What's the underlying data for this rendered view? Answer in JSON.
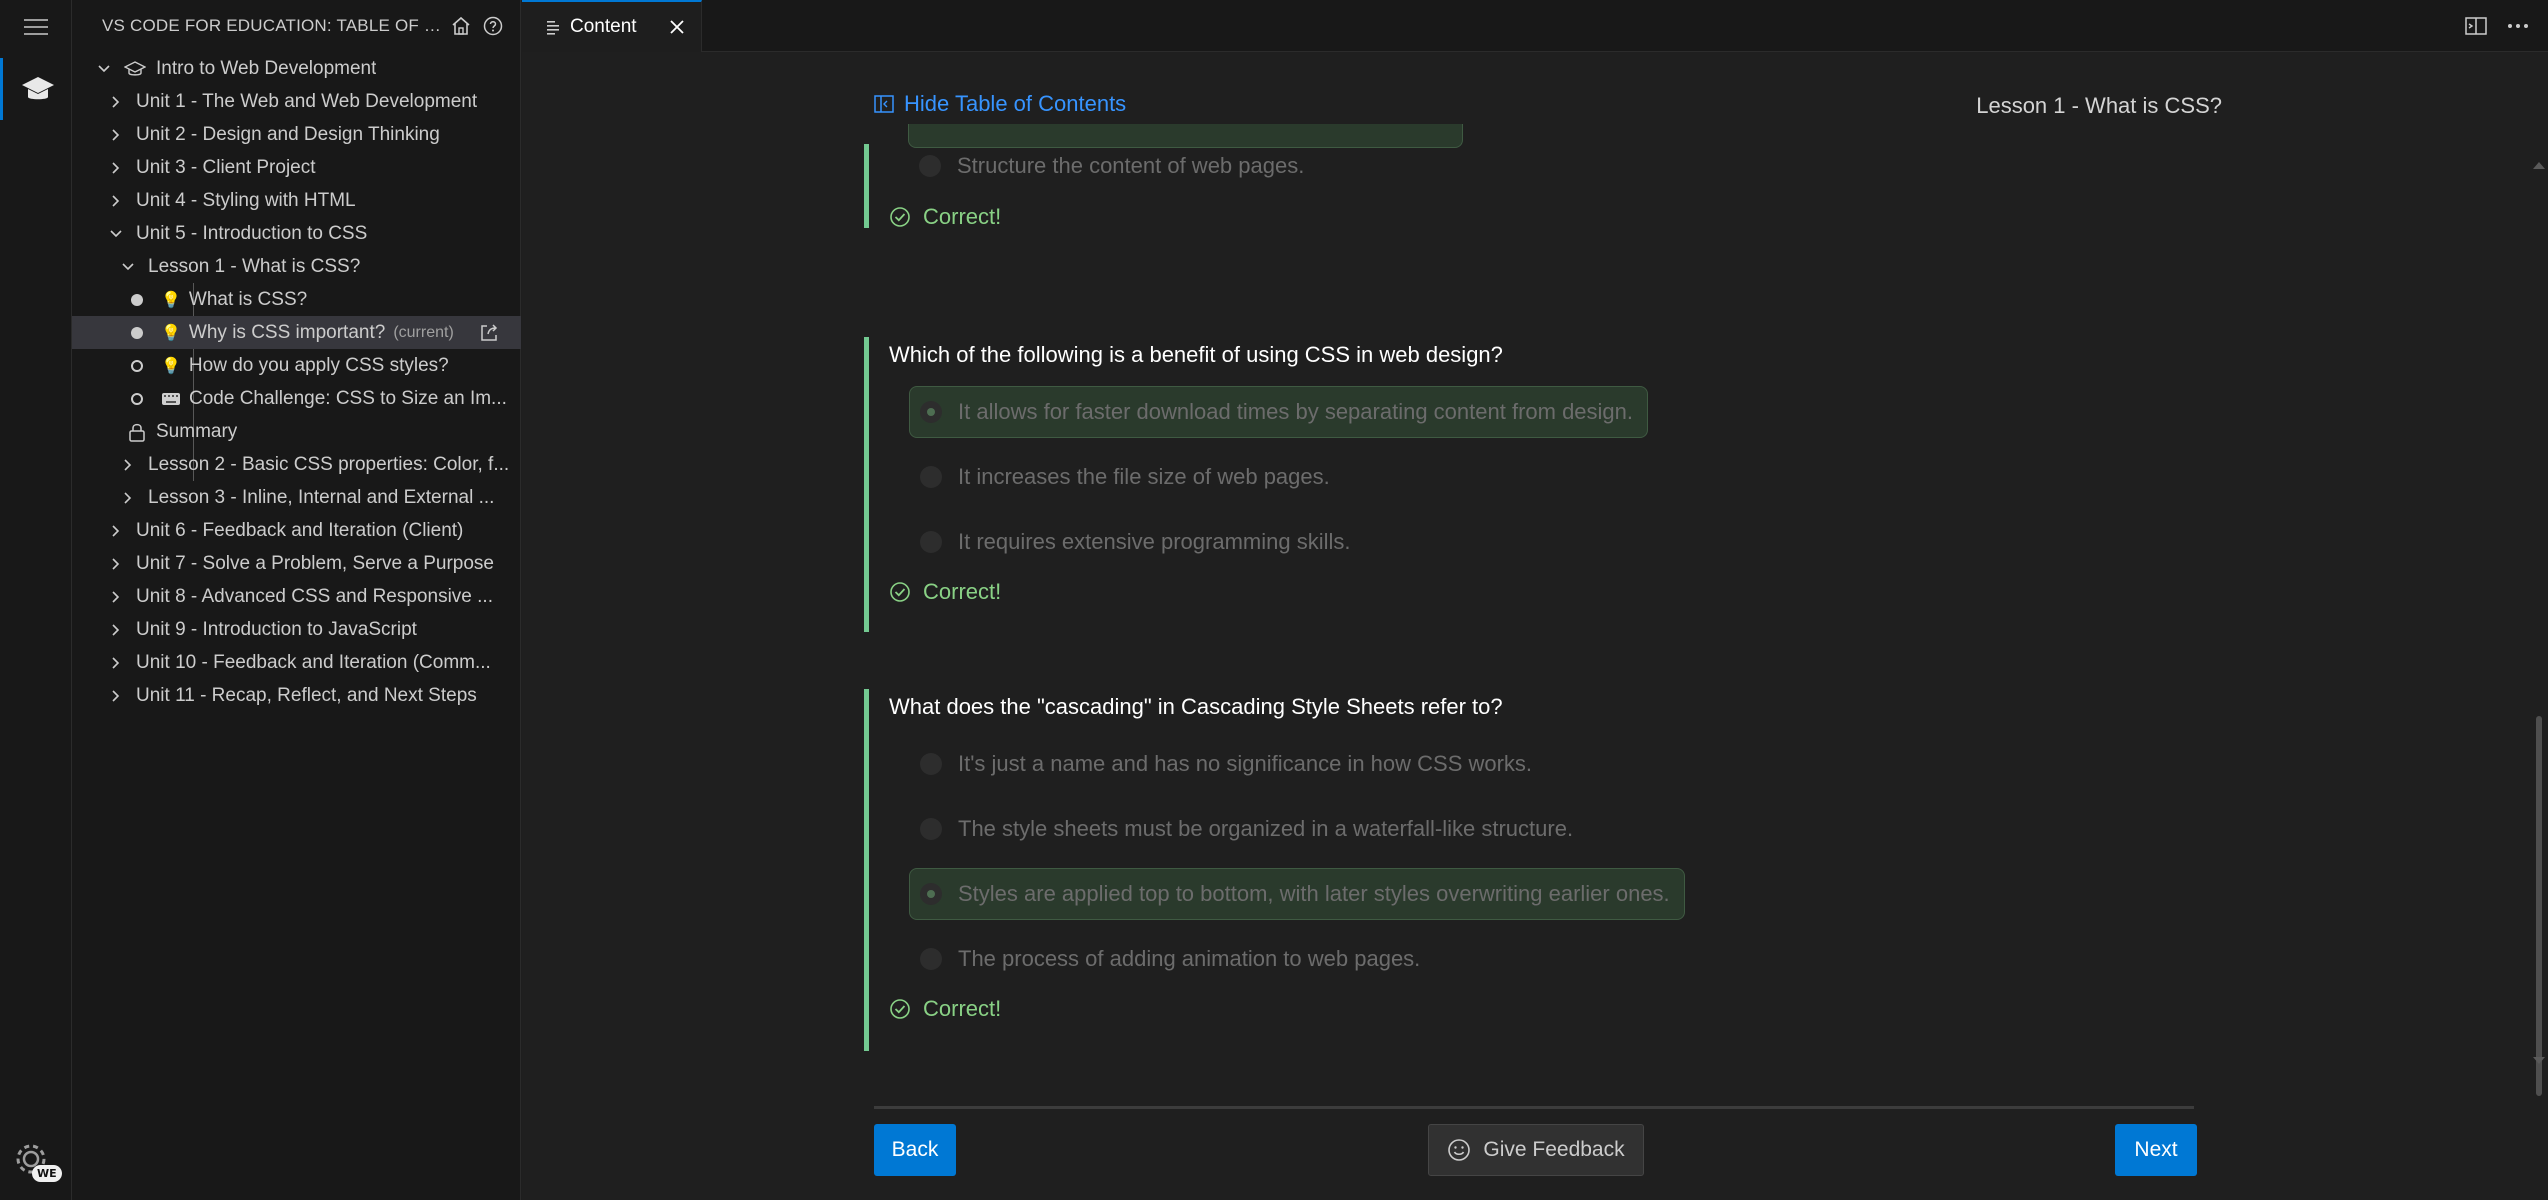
{
  "sidebar": {
    "title": "VS CODE FOR EDUCATION: TABLE OF CON...",
    "tree": [
      {
        "label": "Intro to Web Development",
        "kind": "course"
      },
      {
        "label": "Unit 1 - The Web and Web Development"
      },
      {
        "label": "Unit 2 - Design and Design Thinking"
      },
      {
        "label": "Unit 3 - Client Project"
      },
      {
        "label": "Unit 4 - Styling with HTML"
      },
      {
        "label": "Unit 5 - Introduction to CSS"
      },
      {
        "label": "Lesson 1 - What is CSS?"
      },
      {
        "label": "What is CSS?"
      },
      {
        "label": "Why is CSS important?",
        "badge": "(current)"
      },
      {
        "label": "How do you apply CSS styles?"
      },
      {
        "label": "Code Challenge: CSS to Size an Im..."
      },
      {
        "label": "Summary"
      },
      {
        "label": "Lesson 2 - Basic CSS properties: Color, f..."
      },
      {
        "label": "Lesson 3 - Inline, Internal and External ..."
      },
      {
        "label": "Unit 6 - Feedback and Iteration (Client)"
      },
      {
        "label": "Unit 7 - Solve a Problem, Serve a Purpose"
      },
      {
        "label": "Unit 8 - Advanced CSS and Responsive ..."
      },
      {
        "label": "Unit 9 - Introduction to JavaScript"
      },
      {
        "label": "Unit 10 - Feedback and Iteration (Comm..."
      },
      {
        "label": "Unit 11 - Recap, Reflect, and Next Steps"
      }
    ]
  },
  "tab": {
    "label": "Content"
  },
  "content": {
    "toc_link": "Hide Table of Contents",
    "lesson_title": "Lesson 1 - What is CSS?",
    "q0": {
      "options": [
        "Structure the content of web pages."
      ],
      "result": "Correct!"
    },
    "q1": {
      "question": "Which of the following is a benefit of using CSS in web design?",
      "options": [
        "It allows for faster download times by separating content from design.",
        "It increases the file size of web pages.",
        "It requires extensive programming skills."
      ],
      "selected": 0,
      "result": "Correct!"
    },
    "q2": {
      "question": "What does the \"cascading\" in Cascading Style Sheets refer to?",
      "options": [
        "It's just a name and has no significance in how CSS works.",
        "The style sheets must be organized in a waterfall-like structure.",
        "Styles are applied top to bottom, with later styles overwriting earlier ones.",
        "The process of adding animation to web pages."
      ],
      "selected": 2,
      "result": "Correct!"
    },
    "buttons": {
      "back": "Back",
      "feedback": "Give Feedback",
      "next": "Next"
    }
  },
  "activity": {
    "badge": "WE"
  },
  "colors": {
    "accent": "#0078d4",
    "correct": "#89d185",
    "link": "#3794ff"
  }
}
